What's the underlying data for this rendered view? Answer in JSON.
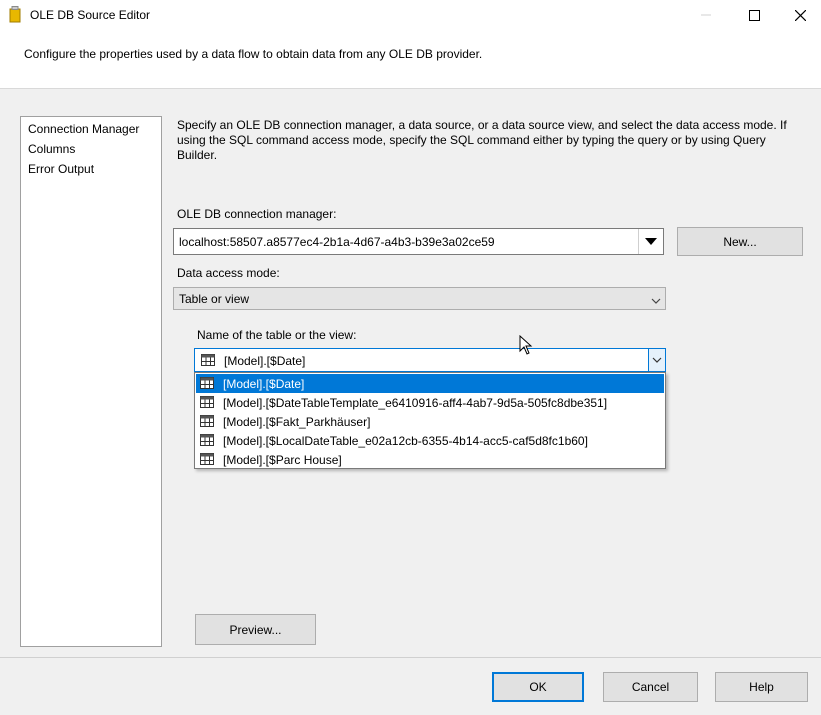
{
  "window": {
    "title": "OLE DB Source Editor",
    "description": "Configure the properties used by a data flow to obtain data from any OLE DB provider."
  },
  "nav": {
    "items": [
      {
        "label": "Connection Manager"
      },
      {
        "label": "Columns"
      },
      {
        "label": "Error Output"
      }
    ]
  },
  "main": {
    "instructions": "Specify an OLE DB connection manager, a data source, or a data source view, and select the data access mode. If using the SQL command access mode, specify the SQL command either by typing the query or by using Query Builder.",
    "connection_label": "OLE DB connection manager:",
    "connection_value": "localhost:58507.a8577ec4-2b1a-4d67-a4b3-b39e3a02ce59",
    "new_button": "New...",
    "access_mode_label": "Data access mode:",
    "access_mode_value": "Table or view",
    "table_label": "Name of the table or the view:",
    "table_value": "[Model].[$Date]",
    "table_options": [
      {
        "label": "[Model].[$Date]",
        "selected": true
      },
      {
        "label": "[Model].[$DateTableTemplate_e6410916-aff4-4ab7-9d5a-505fc8dbe351]",
        "selected": false
      },
      {
        "label": "[Model].[$Fakt_Parkhäuser]",
        "selected": false
      },
      {
        "label": "[Model].[$LocalDateTable_e02a12cb-6355-4b14-acc5-caf5d8fc1b60]",
        "selected": false
      },
      {
        "label": "[Model].[$Parc House]",
        "selected": false
      }
    ],
    "preview_button": "Preview..."
  },
  "footer": {
    "ok": "OK",
    "cancel": "Cancel",
    "help": "Help"
  },
  "colors": {
    "selection": "#0078d7",
    "ok_border": "#0078d7"
  }
}
